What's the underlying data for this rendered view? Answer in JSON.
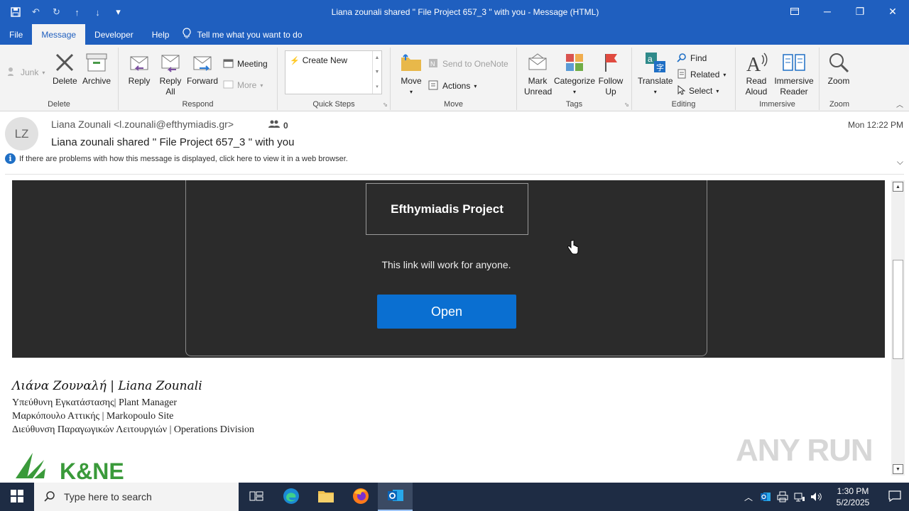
{
  "window": {
    "title": "Liana zounali shared \" File Project 657_3 \" with you  -  Message (HTML)"
  },
  "tabs": [
    "File",
    "Message",
    "Developer",
    "Help"
  ],
  "tell_me": "Tell me what you want to do",
  "ribbon": {
    "delete_group": {
      "label": "Delete",
      "junk": "Junk",
      "delete": "Delete",
      "archive": "Archive"
    },
    "respond_group": {
      "label": "Respond",
      "reply": "Reply",
      "reply_all": "Reply All",
      "forward": "Forward",
      "meeting": "Meeting",
      "more": "More"
    },
    "quick_steps": {
      "label": "Quick Steps",
      "create_new": "Create New"
    },
    "move_group": {
      "label": "Move",
      "move": "Move",
      "send_onenote": "Send to OneNote",
      "actions": "Actions"
    },
    "tags_group": {
      "label": "Tags",
      "mark_unread": "Mark Unread",
      "categorize": "Categorize",
      "follow_up": "Follow Up"
    },
    "editing_group": {
      "label": "Editing",
      "translate": "Translate",
      "find": "Find",
      "related": "Related",
      "select": "Select"
    },
    "immersive_group": {
      "label": "Immersive",
      "read_aloud": "Read Aloud",
      "immersive_reader": "Immersive Reader"
    },
    "zoom_group": {
      "label": "Zoom",
      "zoom": "Zoom"
    }
  },
  "message": {
    "avatar_initials": "LZ",
    "from": "Liana Zounali <l.zounali@efthymiadis.gr>",
    "people_count": "0",
    "subject": "Liana zounali shared '' File Project 657_3 '' with you",
    "date": "Mon 12:22 PM",
    "info": "If there are problems with how this message is displayed, click here to view it in a web browser."
  },
  "body": {
    "project_title": "Efthymiadis Project",
    "link_text": "This link will work for anyone.",
    "open_button": "Open",
    "signature_name": "Λιάνα Ζουναλή | Liana Zounali",
    "signature_lines": [
      "Υπεύθυνη Εγκατάστασης| Plant Manager",
      "Μαρκόπουλο Αττικής | Markopoulo Site",
      "Διεύθυνση Παραγωγικών Λειτουργιών | Operations Division"
    ],
    "logo_text": "K&NE"
  },
  "watermark": "ANY RUN",
  "taskbar": {
    "search_placeholder": "Type here to search",
    "time": "1:30 PM",
    "date": "5/2/2025"
  },
  "colors": {
    "titlebar": "#1f5fbf",
    "ribbon": "#f3f3f3",
    "dark_band": "#2b2b2b",
    "open_button": "#0a6fd1",
    "taskbar": "#1e2c44"
  }
}
